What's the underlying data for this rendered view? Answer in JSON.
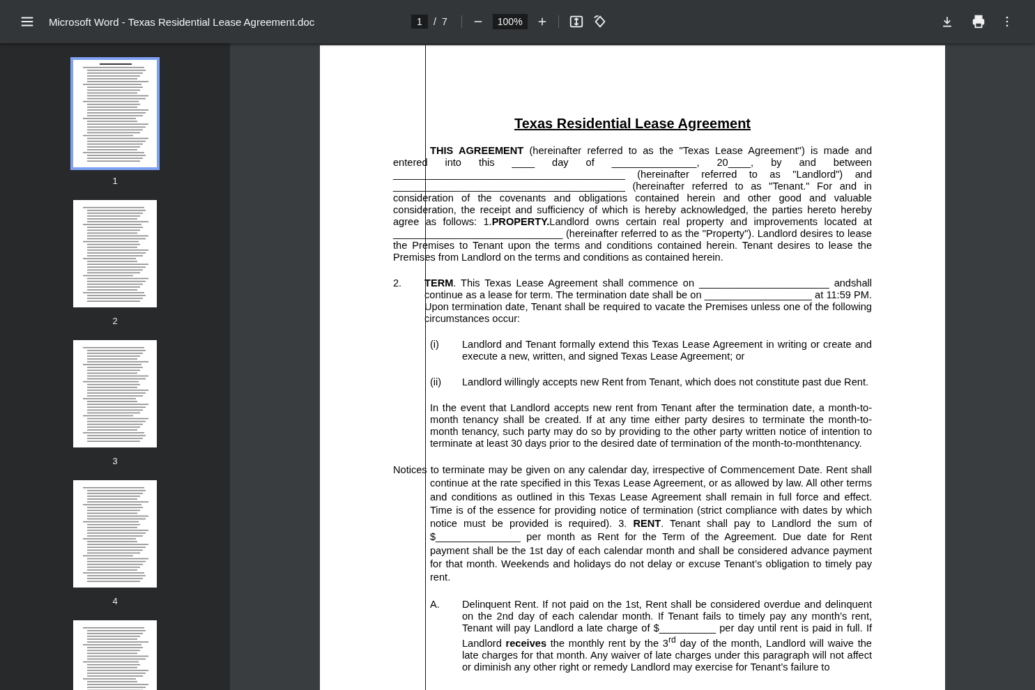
{
  "toolbar": {
    "title": "Microsoft Word - Texas Residential Lease Agreement.doc",
    "page_current": "1",
    "page_separator": "/",
    "page_total": "7",
    "zoom": "100%"
  },
  "thumbnails": [
    {
      "label": "1",
      "selected": true
    },
    {
      "label": "2",
      "selected": false
    },
    {
      "label": "3",
      "selected": false
    },
    {
      "label": "4",
      "selected": false
    },
    {
      "selected": false
    }
  ],
  "document": {
    "title": "Texas Residential Lease Agreement",
    "blocks": [
      {
        "kind": "intro",
        "text": "**THIS AGREEMENT** (hereinafter referred to as the \"Texas Lease Agreement\") is made and entered into this ____ day of _______________, 20____, by and between _________________________________________ (hereinafter referred to as \"Landlord\") and _________________________________________ (hereinafter referred to as \"Tenant.\" For and in consideration of the covenants and obligations contained herein and other good and valuable consideration, the receipt and sufficiency of which is hereby acknowledged, the parties hereto hereby agree as follows: 1.**PROPERTY.**Landlord owns certain real property and improvements located at ______________________________ (hereinafter referred to as the \"Property\"). Landlord desires to lease the Premises to Tenant upon the terms and conditions contained herein. Tenant desires to lease the Premises from Landlord on the terms and conditions as contained herein."
      },
      {
        "kind": "numbered",
        "marker": "2.",
        "text": "**TERM**.  This Texas Lease Agreement shall commence on _______________________ andshall continue as a lease for term. The termination date shall be on ___________________ at 11:59 PM. Upon termination date, Tenant shall be required to vacate the Premises unless one of the following circumstances occur:"
      },
      {
        "kind": "item",
        "marker": "(i)",
        "text": "Landlord and Tenant formally extend this Texas Lease Agreement in writing or create and execute a new, written, and signed Texas Lease Agreement; or"
      },
      {
        "kind": "item",
        "marker": "(ii)",
        "text": "Landlord willingly accepts new Rent from Tenant, which does not constitute past due Rent."
      },
      {
        "kind": "block",
        "text": "In the event that Landlord accepts new rent from Tenant after the termination date, a month-to-month tenancy shall be created. If at any time either party desires to terminate the month-to-month tenancy, such party may do so by providing to the other party written notice of intention to terminate at least 30 days prior to the desired date of termination of the month-to-monthtenancy."
      },
      {
        "kind": "hanging",
        "text": "Notices to terminate may be given on any calendar day, irrespective of Commencement Date. Rent shall continue at the rate specified in this Texas Lease Agreement, or as allowed by law. All other terms and conditions as outlined in this Texas Lease Agreement shall remain in full force and effect. Time is of the essence for providing notice of termination (strict compliance with dates by which notice must be provided is required). 3.        **RENT**.  Tenant shall pay to Landlord the sum of $_______________ per month as Rent for the Term of the Agreement. Due date for Rent payment shall be the 1st day of each calendar month and shall be considered advance payment for that month. Weekends and holidays do not delay or excuse Tenant’s obligation to timely pay rent."
      },
      {
        "kind": "item",
        "marker": "A.",
        "text": "Delinquent Rent. If not paid on the 1st, Rent shall be considered overdue and delinquent on the 2nd day of each calendar month. If Tenant fails to timely pay any month’s rent, Tenant will pay Landlord a late charge of $__________ per day until rent is paid in full. If Landlord **receives** the monthly rent by the 3$^{rd}$ day of the month, Landlord will waive the late charges for that month. Any waiver of late charges under this paragraph will not affect or diminish any other right or remedy Landlord may exercise for Tenant’s failure to"
      }
    ]
  }
}
